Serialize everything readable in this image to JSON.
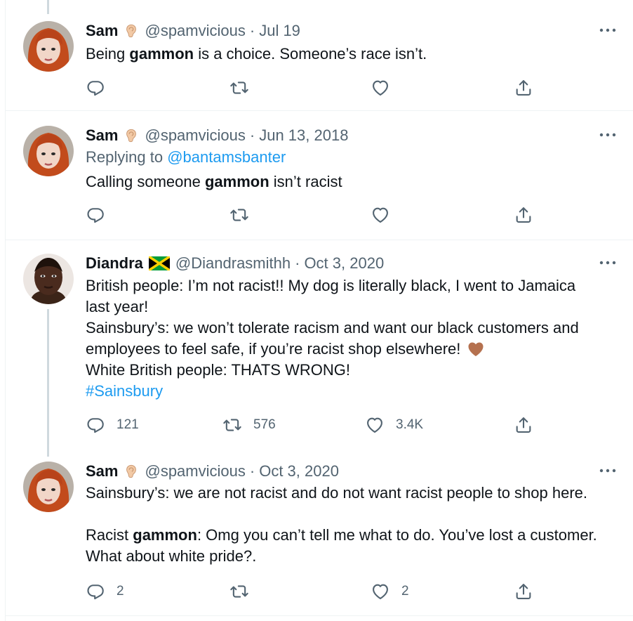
{
  "tweets": [
    {
      "name": "Sam",
      "handle": "@spamvicious",
      "date": "Jul 19",
      "text_before": "Being ",
      "text_bold": "gammon",
      "text_after": " is a choice. Someone’s race isn’t.",
      "reply_count": "",
      "retweet_count": "",
      "like_count": ""
    },
    {
      "name": "Sam",
      "handle": "@spamvicious",
      "date": "Jun 13, 2018",
      "replying_prefix": "Replying to ",
      "replying_handle": "@bantamsbanter",
      "text_before": "Calling someone ",
      "text_bold": "gammon",
      "text_after": " isn’t racist",
      "reply_count": "",
      "retweet_count": "",
      "like_count": ""
    },
    {
      "name": "Diandra",
      "handle": "@Diandrasmithh",
      "date": "Oct 3, 2020",
      "line1": "British people: I’m not racist!! My dog is literally black, I went to Jamaica",
      "line2": "last year!",
      "line3": "Sainsbury’s: we won’t tolerate racism and want our black customers and",
      "line4": "employees to feel safe, if you’re racist shop elsewhere!",
      "line5": "White British people: THATS WRONG!",
      "hashtag": "#Sainsbury",
      "reply_count": "121",
      "retweet_count": "576",
      "like_count": "3.4K"
    },
    {
      "name": "Sam",
      "handle": "@spamvicious",
      "date": "Oct 3, 2020",
      "line1": "Sainsbury’s: we are not racist and do not want racist people to shop here.",
      "line3_prefix": "Racist ",
      "line3_bold": "gammon",
      "line3_after": ": Omg you can’t tell me what to do. You’ve lost a customer.",
      "line4": "What about white pride?.",
      "reply_count": "2",
      "retweet_count": "",
      "like_count": "2"
    }
  ],
  "separator_dot": "·",
  "icons": {
    "reply": "reply-icon",
    "retweet": "retweet-icon",
    "like": "like-icon",
    "share": "share-icon",
    "more": "more-icon",
    "badge": "ear-emoji-icon",
    "flag": "jamaica-flag-icon",
    "heart_emoji": "brown-heart-icon"
  },
  "colors": {
    "text": "#0f1419",
    "secondary": "#536471",
    "link": "#1d9bf0",
    "thread_line": "#cfd9de",
    "divider": "#eff3f4"
  }
}
